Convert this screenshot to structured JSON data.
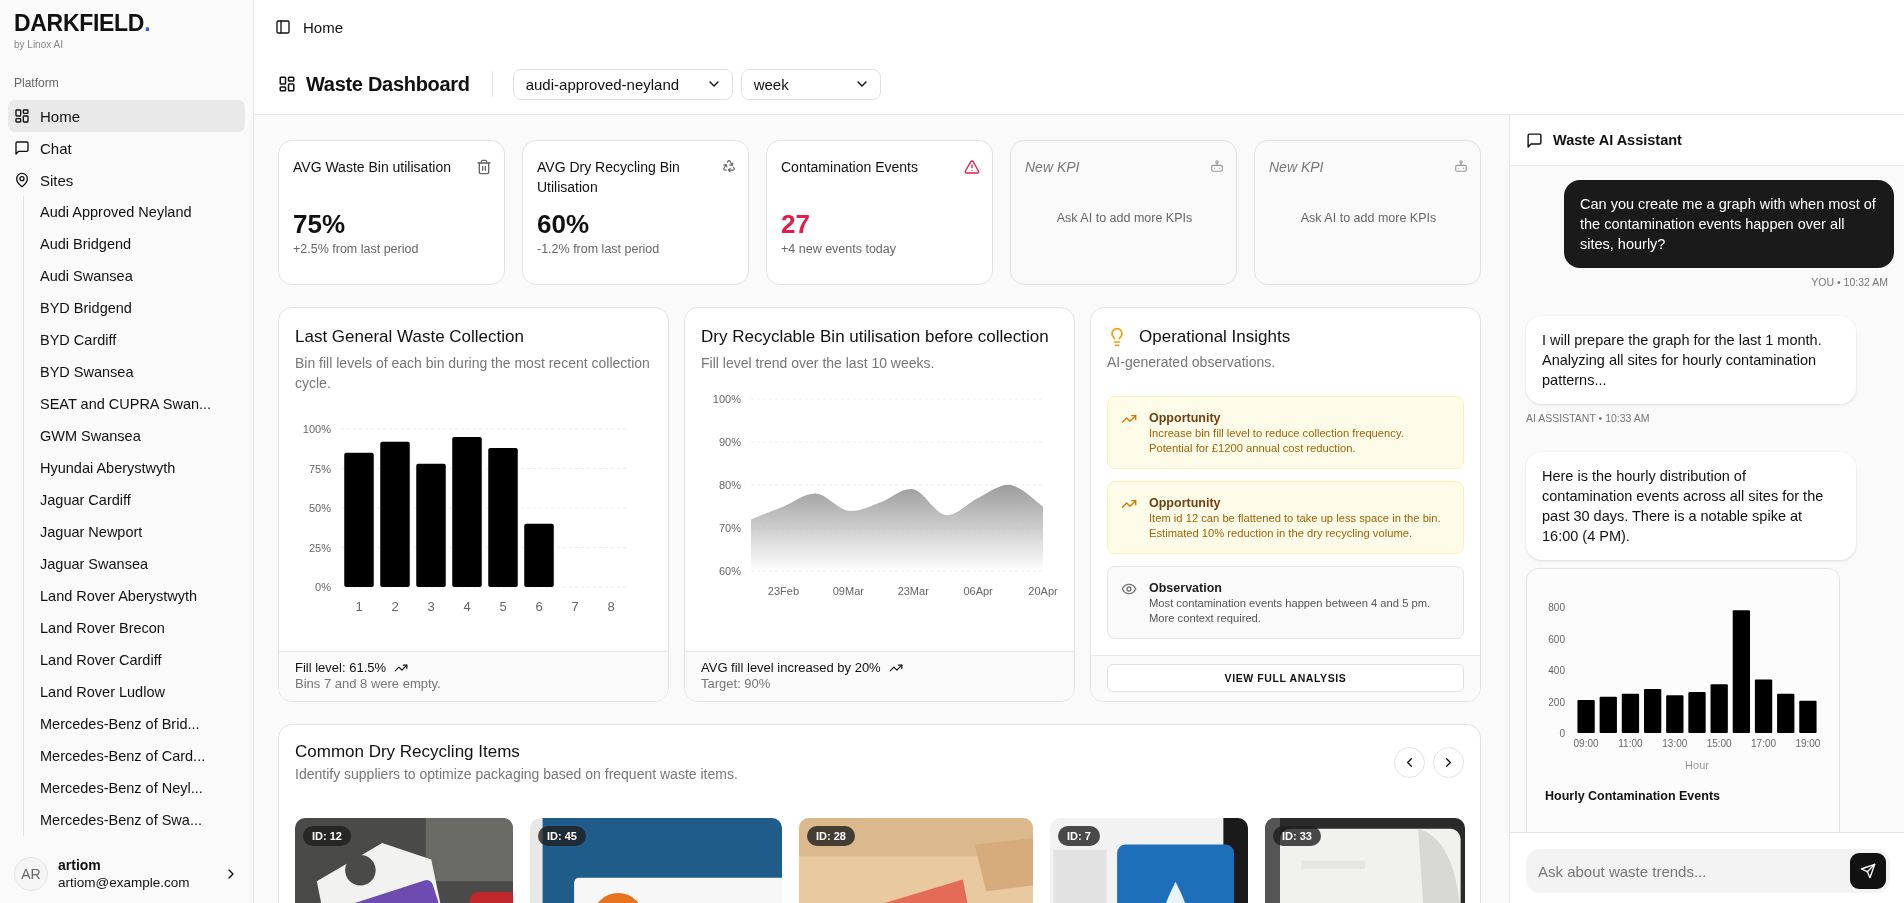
{
  "sidebar": {
    "logo": {
      "name": "DARKFIELD",
      "mark": "."
    },
    "tagline": "by Linox AI",
    "section": "Platform",
    "items": [
      {
        "label": "Home",
        "selected": true
      },
      {
        "label": "Chat",
        "selected": false
      },
      {
        "label": "Sites",
        "selected": false,
        "children": [
          {
            "label": "Audi Approved Neyland",
            "selected": false
          },
          {
            "label": "Audi Bridgend",
            "selected": false
          },
          {
            "label": "Audi Swansea",
            "selected": false
          },
          {
            "label": "BYD Bridgend",
            "selected": false
          },
          {
            "label": "BYD Cardiff",
            "selected": false
          },
          {
            "label": "BYD Swansea",
            "selected": false
          },
          {
            "label": "SEAT and CUPRA Swan...",
            "selected": false
          },
          {
            "label": "GWM Swansea",
            "selected": false
          },
          {
            "label": "Hyundai Aberystwyth",
            "selected": false
          },
          {
            "label": "Jaguar Cardiff",
            "selected": false
          },
          {
            "label": "Jaguar Newport",
            "selected": false
          },
          {
            "label": "Jaguar Swansea",
            "selected": false
          },
          {
            "label": "Land Rover Aberystwyth",
            "selected": false
          },
          {
            "label": "Land Rover Brecon",
            "selected": false
          },
          {
            "label": "Land Rover Cardiff",
            "selected": false
          },
          {
            "label": "Land Rover Ludlow",
            "selected": false
          },
          {
            "label": "Mercedes-Benz of Brid...",
            "selected": false
          },
          {
            "label": "Mercedes-Benz of Card...",
            "selected": false
          },
          {
            "label": "Mercedes-Benz of Neyl...",
            "selected": false
          },
          {
            "label": "Mercedes-Benz of Swa...",
            "selected": false
          }
        ]
      }
    ],
    "user": {
      "initials": "AR",
      "name": "artiom",
      "email": "artiom@example.com"
    }
  },
  "topbar": {
    "breadcrumb": "Home"
  },
  "dashboard": {
    "title": "Waste Dashboard",
    "filters": [
      {
        "value": "audi-approved-neyland"
      },
      {
        "value": "week"
      }
    ]
  },
  "kpis": [
    {
      "kind": "metric",
      "label": "AVG Waste Bin utilisation",
      "value": "75%",
      "note": "+2.5% from last period"
    },
    {
      "kind": "metric",
      "label": "AVG Dry Recycling Bin Utilisation",
      "value": "60%",
      "note": "-1.2% from last period"
    },
    {
      "kind": "alert",
      "label": "Contamination Events",
      "value": "27",
      "note": "+4 new events today"
    },
    {
      "kind": "placeholder",
      "label": "New KPI",
      "note": "Ask AI to add more KPIs"
    },
    {
      "kind": "placeholder",
      "label": "New KPI",
      "note": "Ask AI to add more KPIs"
    }
  ],
  "charts": [
    {
      "title": "Last General Waste Collection",
      "subtitle": "Bin fill levels of each bin during the most recent collection cycle.",
      "footer_title": "Fill level: 61.5%",
      "footer_note": "Bins 7 and 8 were empty.",
      "chart_data": {
        "type": "bar",
        "grid": true,
        "categories": [
          "1",
          "2",
          "3",
          "4",
          "5",
          "6",
          "7",
          "8"
        ],
        "values": [
          85,
          92,
          78,
          95,
          88,
          40,
          0,
          0
        ],
        "ylim": [
          0,
          100
        ],
        "yticks": [
          {
            "value": 0,
            "label": "0%"
          },
          {
            "value": 25,
            "label": "25%"
          },
          {
            "value": 50,
            "label": "50%"
          },
          {
            "value": 75,
            "label": "75%"
          },
          {
            "value": 100,
            "label": "100%"
          }
        ]
      }
    },
    {
      "title": "Dry Recyclable Bin utilisation before collection",
      "subtitle": "Fill level trend over the last 10 weeks.",
      "footer_title": "AVG fill level increased by 20%",
      "footer_note": "Target: 90%",
      "chart_data": {
        "type": "area",
        "grid": true,
        "categories": [
          null,
          "23Feb",
          null,
          "09Mar",
          null,
          "23Mar",
          null,
          "06Apr",
          null,
          "20Apr"
        ],
        "values": [
          72,
          75,
          78,
          74,
          76,
          79,
          73,
          77,
          80,
          75
        ],
        "ylim": [
          60,
          100
        ],
        "yticks": [
          {
            "value": 60,
            "label": "60%"
          },
          {
            "value": 70,
            "label": "70%"
          },
          {
            "value": 80,
            "label": "80%"
          },
          {
            "value": 90,
            "label": "90%"
          },
          {
            "value": 100,
            "label": "100%"
          }
        ]
      }
    }
  ],
  "insights": {
    "title": "Operational Insights",
    "subtitle": "AI-generated observations.",
    "items": [
      {
        "kind": "opportunity",
        "title": "Opportunity",
        "text": "Increase bin fill level to reduce collection frequency. Potential for £1200 annual cost reduction."
      },
      {
        "kind": "opportunity",
        "title": "Opportunity",
        "text": "Item id 12 can be flattened to take up less space in the bin. Estimated 10% reduction in the dry recycling volume."
      },
      {
        "kind": "observation",
        "title": "Observation",
        "text": "Most contamination events happen between 4 and 5 pm. More context required."
      }
    ],
    "button": "VIEW FULL ANALYSIS"
  },
  "recycling_items": {
    "title": "Common Dry Recycling Items",
    "subtitle": "Identify suppliers to optimize packaging based on frequent waste items.",
    "items": [
      {
        "badge": "ID: 12"
      },
      {
        "badge": "ID: 45"
      },
      {
        "badge": "ID: 28"
      },
      {
        "badge": "ID: 7"
      },
      {
        "badge": "ID: 33"
      }
    ]
  },
  "chat": {
    "title": "Waste AI Assistant",
    "messages": [
      {
        "kind": "user",
        "text": "Can you create me a graph with when most of the contamination events happen over all sites, hourly?",
        "meta": "YOU • 10:32 AM"
      },
      {
        "kind": "assistant",
        "text": "I will prepare the graph for the last 1 month. Analyzing all sites for hourly contamination patterns...",
        "meta": "AI ASSISTANT • 10:33 AM"
      },
      {
        "kind": "assistant",
        "text": "Here is the hourly distribution of contamination events across all sites for the past 30 days. There is a notable spike at 16:00 (4 PM)."
      },
      {
        "kind": "chart",
        "chart_data": {
          "type": "bar",
          "title": "Hourly Contamination Events",
          "xlabel": "Hour",
          "x": [
            9,
            10,
            11,
            12,
            13,
            14,
            15,
            16,
            17,
            18,
            19
          ],
          "xlim": [
            8.5,
            19.5
          ],
          "values": [
            210,
            230,
            250,
            280,
            240,
            260,
            310,
            780,
            340,
            250,
            205
          ],
          "ylim": [
            0,
            800
          ],
          "yticks": [
            0,
            200,
            400,
            600,
            800
          ],
          "xticks": [
            {
              "value": 9,
              "label": "09:00"
            },
            {
              "value": 11,
              "label": "11:00"
            },
            {
              "value": 13,
              "label": "13:00"
            },
            {
              "value": 15,
              "label": "15:00"
            },
            {
              "value": 17,
              "label": "17:00"
            },
            {
              "value": 19,
              "label": "19:00"
            }
          ]
        }
      }
    ],
    "input": {
      "placeholder": "Ask about waste trends..."
    }
  }
}
